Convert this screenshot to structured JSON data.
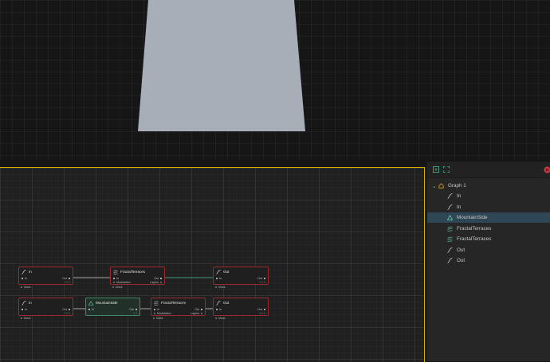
{
  "viewport": {
    "colors": {
      "plane": "#a7aeb8",
      "background": "#161616"
    }
  },
  "graph": {
    "accent_border": "#d4b000",
    "nodes": {
      "in_top": {
        "title": "In",
        "in_label": "In",
        "out_label": "Out",
        "value": "0 0 0",
        "foot": "Mask"
      },
      "fractal_top": {
        "title": "FractalTerraces",
        "in_label": "In",
        "in2_label": "Modulation",
        "out_label": "Out",
        "out2_label": "Layers",
        "foot": "Mask"
      },
      "out_top": {
        "title": "Out",
        "in_label": "In",
        "out_label": "Out",
        "value": "0 0 0",
        "foot": "Mask"
      },
      "in_bottom": {
        "title": "In",
        "in_label": "In",
        "out_label": "Out",
        "value": "0 0 0",
        "foot": "Mask"
      },
      "mountain": {
        "title": "MountainSide",
        "in_label": "In",
        "out_label": "Out",
        "value": "0 0"
      },
      "fractal_bottom": {
        "title": "FractalTerraces",
        "in_label": "In",
        "in2_label": "Modulation",
        "out_label": "Out",
        "out2_label": "Layers",
        "foot": "Mask"
      },
      "out_bottom": {
        "title": "Out",
        "in_label": "In",
        "out_label": "Out",
        "value": "0 0 0",
        "foot": "Mask"
      }
    }
  },
  "panel": {
    "toolbar": {
      "icons": [
        "expand-icon",
        "fullscreen-icon",
        "close-icon"
      ]
    },
    "tree": {
      "root": "Graph 1",
      "items": [
        "In",
        "In",
        "MountainSide",
        "FractalTerraces",
        "FractalTerraces",
        "Out",
        "Out"
      ],
      "active_index": 2
    }
  }
}
